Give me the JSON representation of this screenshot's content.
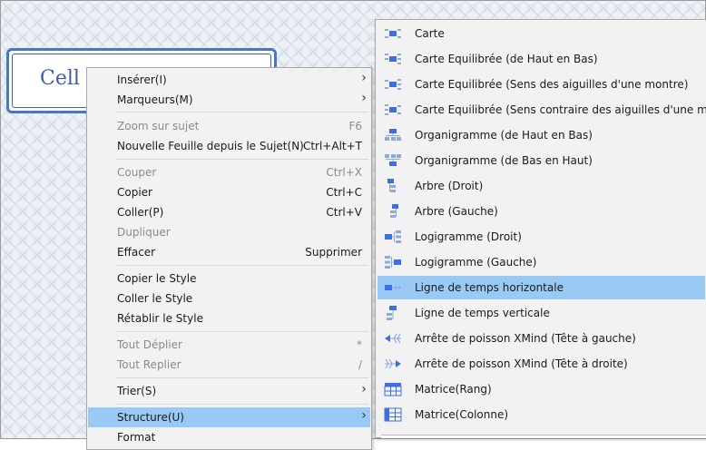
{
  "topic": {
    "text": "Cell"
  },
  "context_menu": {
    "items": [
      {
        "label": "Insérer(I)",
        "shortcut": "",
        "submenu": true,
        "disabled": false
      },
      {
        "label": "Marqueurs(M)",
        "shortcut": "",
        "submenu": true,
        "disabled": false
      },
      {
        "label": "Zoom sur sujet",
        "shortcut": "F6",
        "submenu": false,
        "disabled": true
      },
      {
        "label": "Nouvelle Feuille depuis le Sujet(N)",
        "shortcut": "Ctrl+Alt+T",
        "submenu": false,
        "disabled": false
      },
      {
        "label": "Couper",
        "shortcut": "Ctrl+X",
        "submenu": false,
        "disabled": true
      },
      {
        "label": "Copier",
        "shortcut": "Ctrl+C",
        "submenu": false,
        "disabled": false
      },
      {
        "label": "Coller(P)",
        "shortcut": "Ctrl+V",
        "submenu": false,
        "disabled": false
      },
      {
        "label": "Dupliquer",
        "shortcut": "",
        "submenu": false,
        "disabled": true
      },
      {
        "label": "Effacer",
        "shortcut": "Supprimer",
        "submenu": false,
        "disabled": false
      },
      {
        "label": "Copier le Style",
        "shortcut": "",
        "submenu": false,
        "disabled": false
      },
      {
        "label": "Coller le Style",
        "shortcut": "",
        "submenu": false,
        "disabled": false
      },
      {
        "label": "Rétablir le Style",
        "shortcut": "",
        "submenu": false,
        "disabled": false
      },
      {
        "label": "Tout Déplier",
        "shortcut": "*",
        "submenu": false,
        "disabled": true
      },
      {
        "label": "Tout Replier",
        "shortcut": "/",
        "submenu": false,
        "disabled": true
      },
      {
        "label": "Trier(S)",
        "shortcut": "",
        "submenu": true,
        "disabled": false
      },
      {
        "label": "Structure(U)",
        "shortcut": "",
        "submenu": true,
        "disabled": false,
        "highlighted": true
      },
      {
        "label": "Format",
        "shortcut": "",
        "submenu": false,
        "disabled": false
      }
    ]
  },
  "structure_submenu": {
    "items": [
      {
        "label": "Carte",
        "icon": "map-structure-icon"
      },
      {
        "label": "Carte Equilibrée (de Haut en Bas)",
        "icon": "balanced-map-top-down-icon"
      },
      {
        "label": "Carte Equilibrée (Sens des aiguilles d'une montre)",
        "icon": "balanced-map-clockwise-icon"
      },
      {
        "label": "Carte Equilibrée (Sens contraire des aiguilles d'une montre)",
        "icon": "balanced-map-anticlockwise-icon"
      },
      {
        "label": "Organigramme (de Haut en Bas)",
        "icon": "org-chart-down-icon"
      },
      {
        "label": "Organigramme (de Bas en Haut)",
        "icon": "org-chart-up-icon"
      },
      {
        "label": "Arbre (Droit)",
        "icon": "tree-right-icon"
      },
      {
        "label": "Arbre (Gauche)",
        "icon": "tree-left-icon"
      },
      {
        "label": "Logigramme (Droit)",
        "icon": "logic-chart-right-icon"
      },
      {
        "label": "Logigramme (Gauche)",
        "icon": "logic-chart-left-icon"
      },
      {
        "label": "Ligne de temps horizontale",
        "icon": "timeline-horizontal-icon",
        "highlighted": true
      },
      {
        "label": "Ligne de temps verticale",
        "icon": "timeline-vertical-icon"
      },
      {
        "label": "Arrête de poisson XMind (Tête à gauche)",
        "icon": "fishbone-left-icon"
      },
      {
        "label": "Arrête de poisson XMind (Tête à droite)",
        "icon": "fishbone-right-icon"
      },
      {
        "label": "Matrice(Rang)",
        "icon": "matrix-row-icon"
      },
      {
        "label": "Matrice(Colonne)",
        "icon": "matrix-column-icon"
      }
    ]
  },
  "colors": {
    "highlight": "#99c9f5",
    "icon_blue": "#3d6fe0",
    "topic_border": "#4a77c5"
  }
}
